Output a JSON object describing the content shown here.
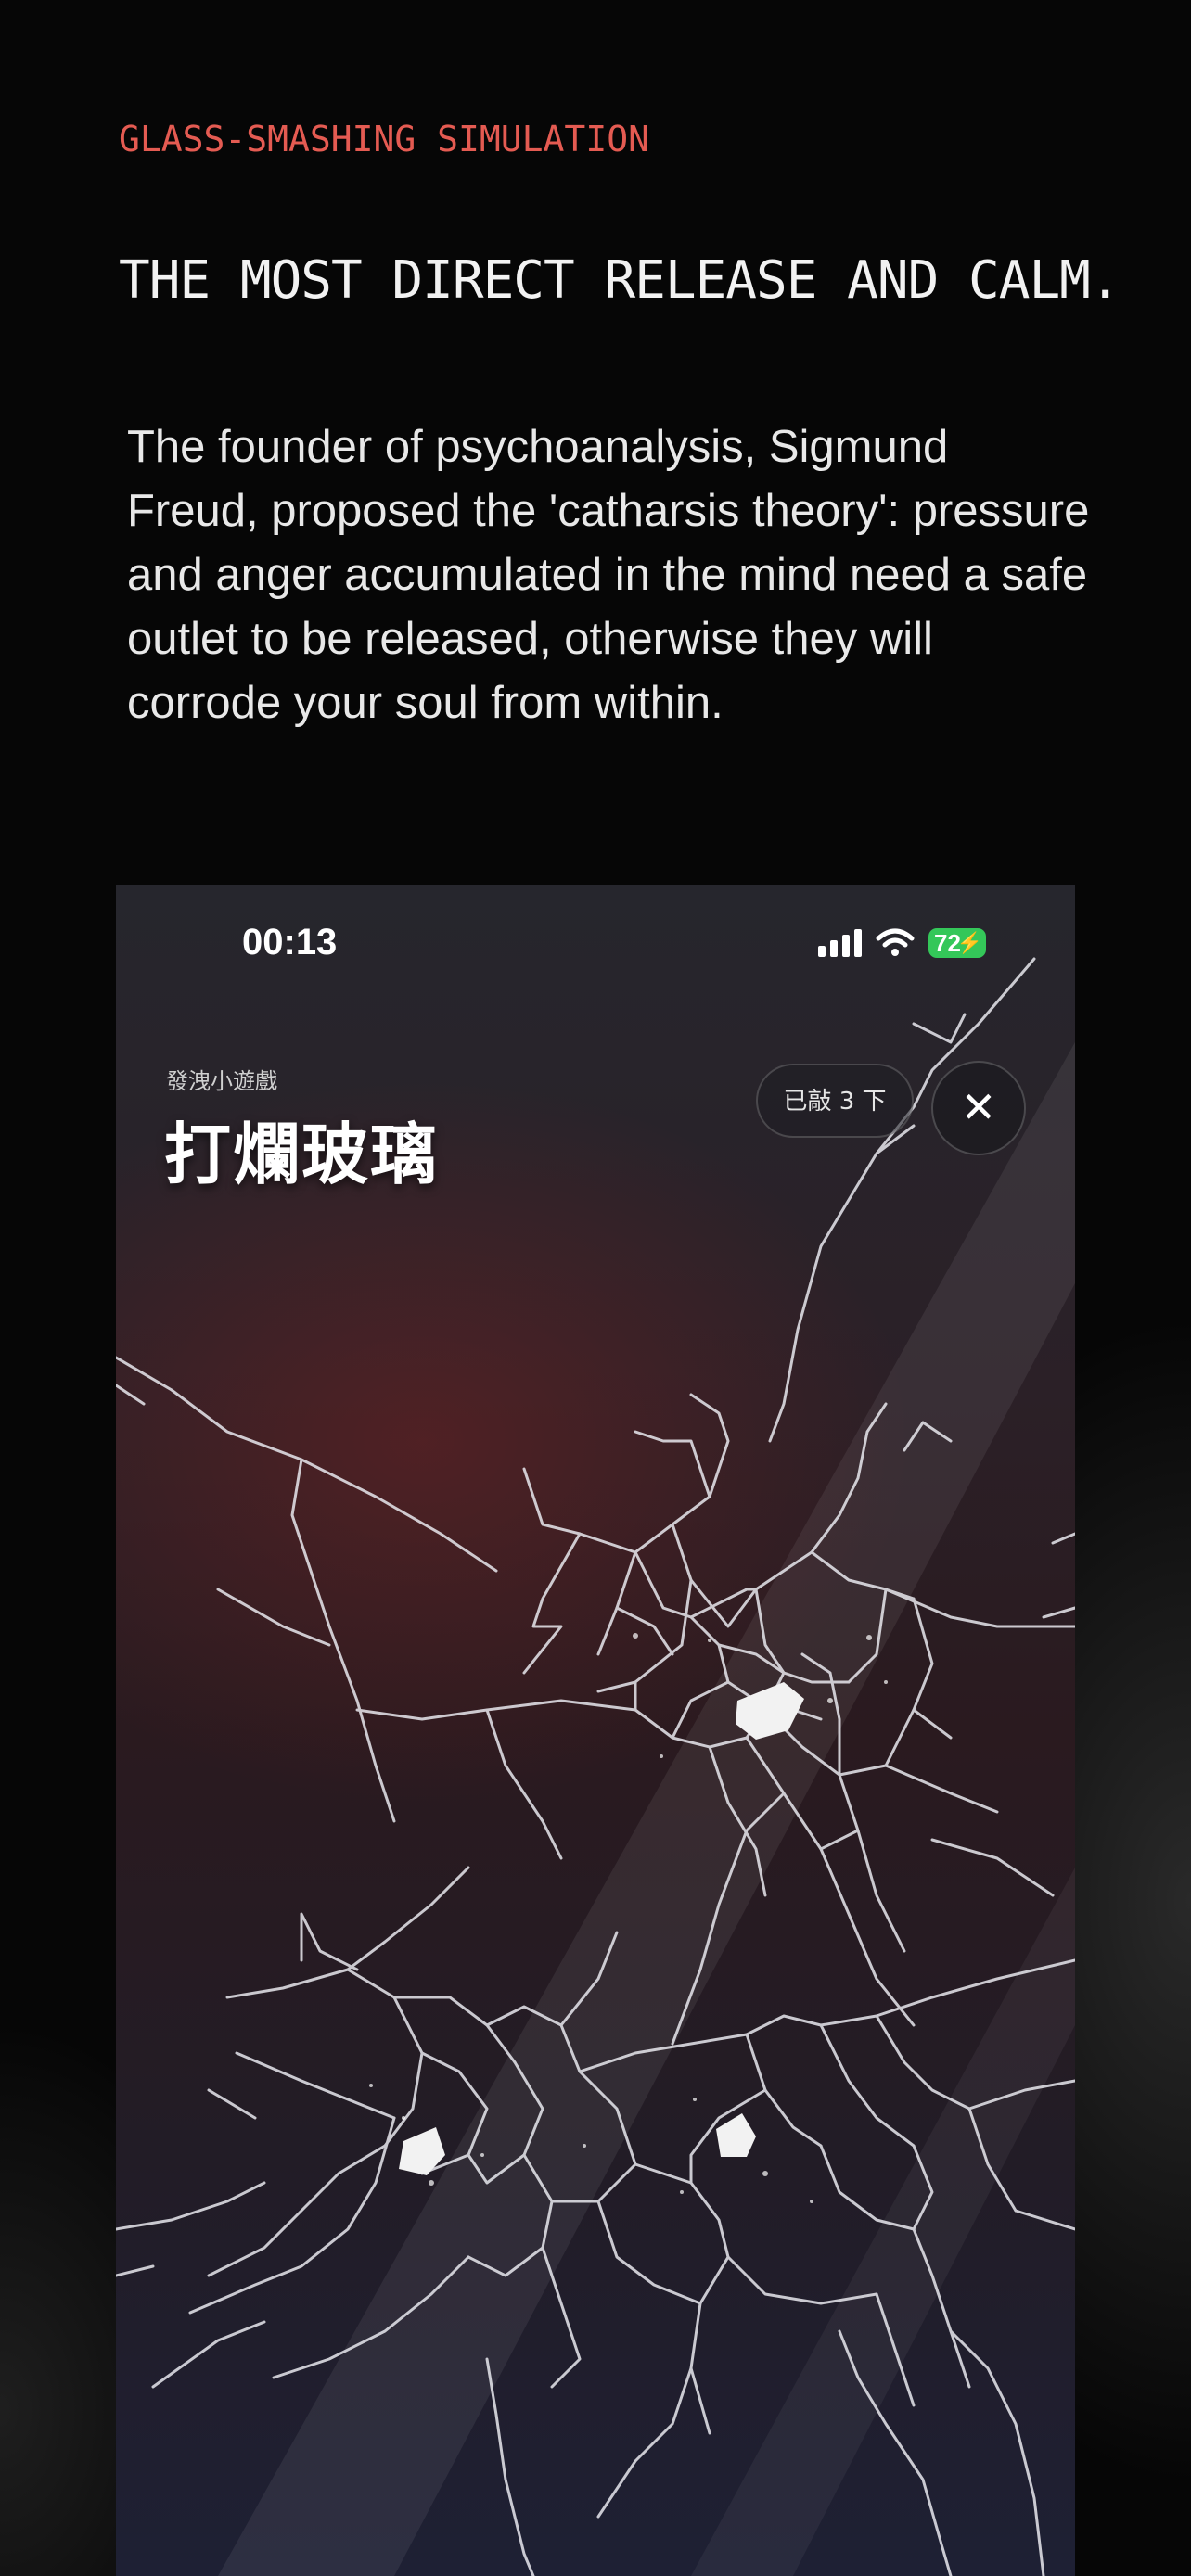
{
  "header": {
    "eyebrow": "GLASS-SMASHING SIMULATION",
    "headline": "THE MOST DIRECT RELEASE AND CALM.",
    "body": "The founder of psychoanalysis, Sigmund Freud, proposed the 'catharsis theory': pressure and anger accumulated in the mind need a safe outlet to be released, otherwise they will corrode your soul from within."
  },
  "phone": {
    "status_bar": {
      "time": "00:13",
      "battery": "72",
      "icons": [
        "signal-icon",
        "wifi-icon",
        "battery-icon",
        "charging-bolt-icon"
      ]
    },
    "game": {
      "caption": "發洩小遊戲",
      "title": "打爛玻璃",
      "hit_counter": "已敲 3 下",
      "close_icon": "close-icon"
    },
    "colors": {
      "battery": "#34c759",
      "eyebrow": "#e45b52"
    }
  }
}
